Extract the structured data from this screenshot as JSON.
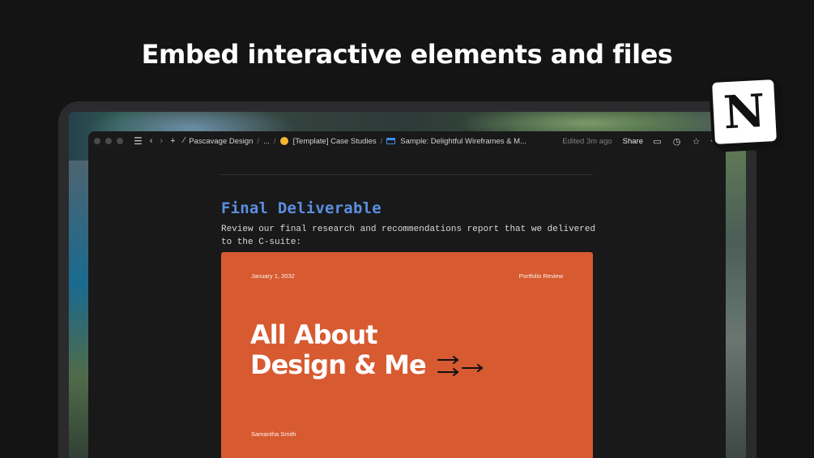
{
  "headline": "Embed interactive elements and files",
  "logo": {
    "letter": "N"
  },
  "titlebar": {
    "breadcrumbs": [
      "Pascavage Design",
      "...",
      "[Template] Case Studies",
      "Sample: Delightful Wireframes & M..."
    ],
    "edited": "Edited 3m ago",
    "share_label": "Share",
    "icons": [
      "menu-icon",
      "back-icon",
      "forward-icon",
      "add-icon",
      "pin-icon",
      "comment-icon",
      "history-icon",
      "star-icon",
      "more-icon"
    ]
  },
  "page": {
    "heading": "Final Deliverable",
    "description": "Review our final research and recommendations report that we delivered to the C-suite:"
  },
  "slide": {
    "date": "January 1, 2032",
    "tag": "Portfolio Review",
    "title_line1": "All About",
    "title_line2": "Design & Me",
    "author": "Samantha Smith",
    "background": "#d75a31"
  },
  "colors": {
    "heading_accent": "#5b8fe0",
    "window_bg": "#191919"
  }
}
